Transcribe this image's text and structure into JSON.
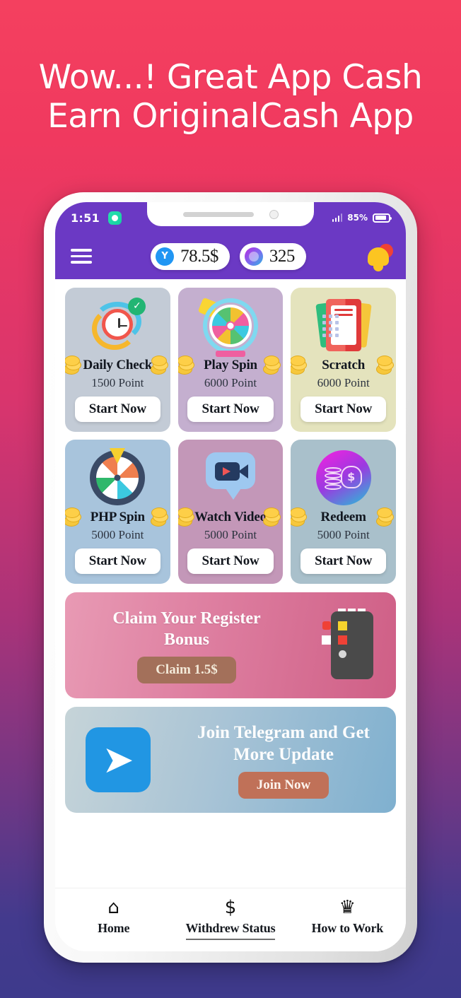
{
  "headline": {
    "line1": "Wow...! Great App Cash",
    "line2": "Earn OriginalCash App"
  },
  "colors": {
    "bg_top": "#f4405f",
    "bg_bottom": "#3e3a8c",
    "appbar_purple": "#6b39c4",
    "coin_yellow": "#f6c73c",
    "telegram_blue": "#2196e3",
    "claim_button": "#a3705a",
    "join_button": "#c07158"
  },
  "status_bar": {
    "time": "1:51",
    "battery_percent": "85%",
    "app_icon": "whatsapp-icon",
    "signal_icon": "signal-bars-icon",
    "battery_icon": "battery-icon"
  },
  "app_bar": {
    "menu_icon": "hamburger-menu-icon",
    "balance": {
      "icon": "coin-icon",
      "value": "78.5$"
    },
    "points": {
      "icon": "points-icon",
      "value": "325"
    },
    "notification_icon": "bell-icon"
  },
  "tasks": [
    {
      "title": "Daily Check",
      "points": "1500 Point",
      "button": "Start Now",
      "art": "clock-check-icon",
      "bg": "#c3cbd6"
    },
    {
      "title": "Play Spin",
      "points": "6000 Point",
      "button": "Start Now",
      "art": "spin-wheel-icon",
      "bg": "#c4afcf"
    },
    {
      "title": "Scratch",
      "points": "6000 Point",
      "button": "Start Now",
      "art": "scratch-card-icon",
      "bg": "#e4e3bd"
    },
    {
      "title": "PHP Spin",
      "points": "5000 Point",
      "button": "Start Now",
      "art": "php-wheel-icon",
      "bg": "#a8c4dc"
    },
    {
      "title": "Watch Video",
      "points": "5000 Point",
      "button": "Start Now",
      "art": "video-bubble-icon",
      "bg": "#c397b8"
    },
    {
      "title": "Redeem",
      "points": "5000 Point",
      "button": "Start Now",
      "art": "money-bag-icon",
      "bg": "#a9c0cb"
    }
  ],
  "bonus_banner": {
    "title_line1": "Claim Your Register",
    "title_line2": "Bonus",
    "button": "Claim 1.5$",
    "art": "smartphone-icon"
  },
  "telegram_banner": {
    "title_line1": "Join Telegram and Get",
    "title_line2": "More Update",
    "button": "Join Now",
    "art": "telegram-icon"
  },
  "bottom_nav": [
    {
      "label": "Home",
      "icon": "home-icon",
      "glyph": "⌂",
      "active": false
    },
    {
      "label": "Withdrew Status",
      "icon": "dollar-icon",
      "glyph": "$",
      "active": true
    },
    {
      "label": "How to Work",
      "icon": "crown-icon",
      "glyph": "♛",
      "active": false
    }
  ]
}
